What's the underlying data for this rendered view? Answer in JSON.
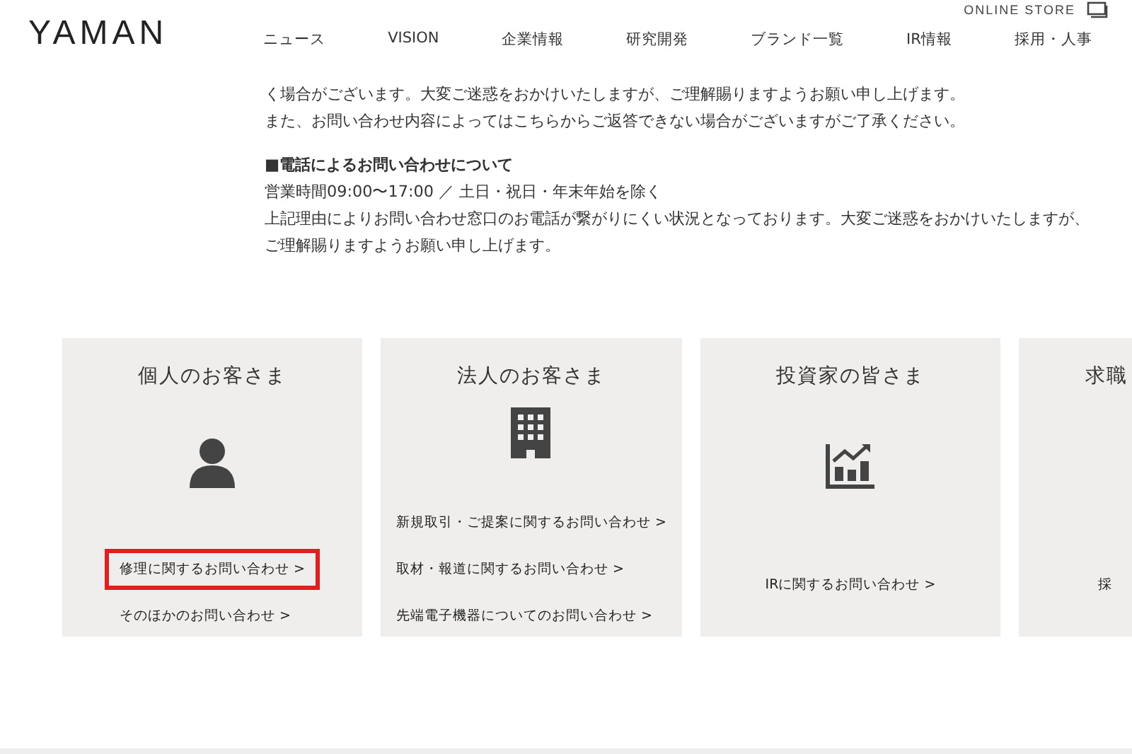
{
  "header": {
    "logo": "YAMAN",
    "online_store": "ONLINE STORE",
    "nav": [
      "ニュース",
      "VISION",
      "企業情報",
      "研究開発",
      "ブランド一覧",
      "IR情報",
      "採用・人事"
    ]
  },
  "notice": {
    "lines": [
      "く場合がございます。大変ご迷惑をおかけいたしますが、ご理解賜りますようお願い申し上げます。",
      "また、お問い合わせ内容によってはこちらからご返答できない場合がございますがご了承ください。"
    ],
    "phone_heading": "■電話によるお問い合わせについて",
    "phone_lines": [
      "営業時間09:00〜17:00 ／ 土日・祝日・年末年始を除く",
      "上記理由によりお問い合わせ窓口のお電話が繋がりにくい状況となっております。大変ご迷惑をおかけいたしますが、",
      "ご理解賜りますようお願い申し上げます。"
    ]
  },
  "cards": [
    {
      "title": "個人のお客さま",
      "links": [
        {
          "text": "修理に関するお問い合わせ >",
          "highlighted": true
        },
        {
          "text": "そのほかのお問い合わせ >",
          "highlighted": false
        }
      ]
    },
    {
      "title": "法人のお客さま",
      "links": [
        {
          "text": "新規取引・ご提案に関するお問い合わせ >",
          "highlighted": false
        },
        {
          "text": "取材・報道に関するお問い合わせ >",
          "highlighted": false
        },
        {
          "text": "先端電子機器についてのお問い合わせ >",
          "highlighted": false
        }
      ]
    },
    {
      "title": "投資家の皆さま",
      "links": [
        {
          "text": "IRに関するお問い合わせ >",
          "highlighted": false
        }
      ]
    },
    {
      "title": "求職",
      "links": [
        {
          "text": "採",
          "highlighted": false
        }
      ]
    }
  ]
}
